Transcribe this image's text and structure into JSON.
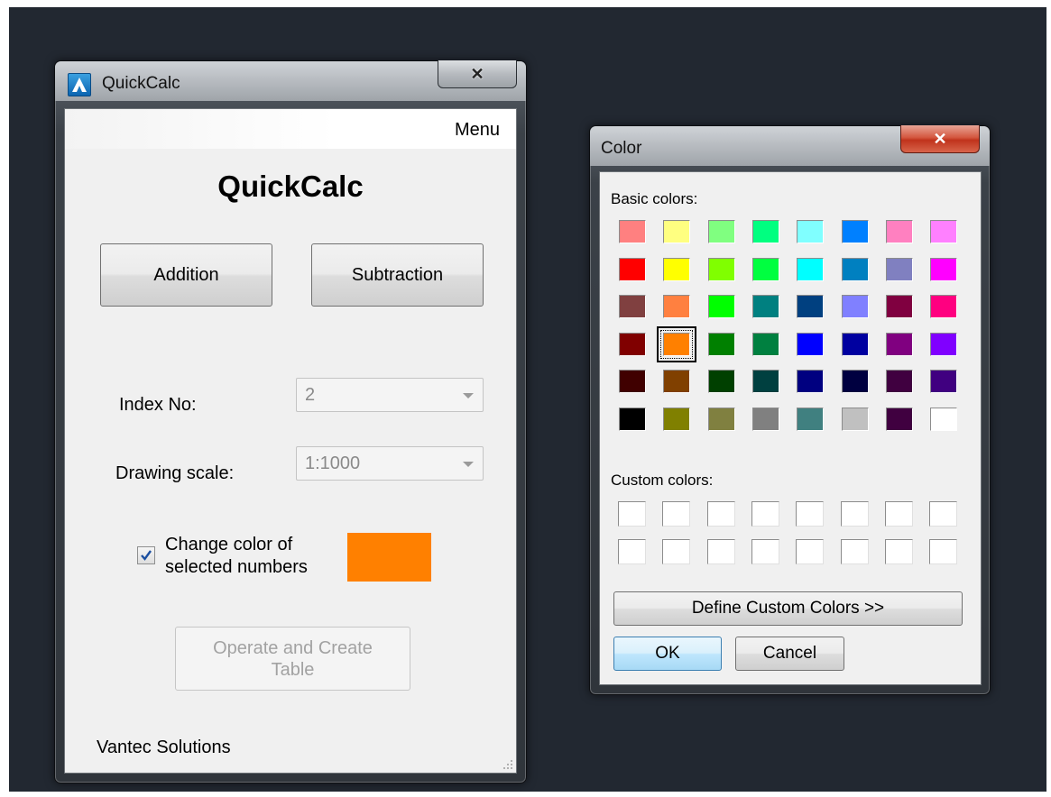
{
  "quickcalc": {
    "window_title": "QuickCalc",
    "close_glyph": "✕",
    "menu_label": "Menu",
    "heading": "QuickCalc",
    "addition_label": "Addition",
    "subtraction_label": "Subtraction",
    "index_label": "Index No:",
    "index_value": "2",
    "scale_label": "Drawing scale:",
    "scale_value": "1:1000",
    "checkbox_checked": true,
    "checkbox_label_line1": "Change color of",
    "checkbox_label_line2": "selected numbers",
    "selected_color": "#ff8000",
    "operate_label_line1": "Operate and Create",
    "operate_label_line2": "Table",
    "company": "Vantec Solutions"
  },
  "color_dialog": {
    "title": "Color",
    "close_glyph": "✕",
    "basic_colors_label": "Basic colors:",
    "basic_colors": [
      [
        "#ff8080",
        "#ffff80",
        "#80ff80",
        "#00ff80",
        "#80ffff",
        "#0080ff",
        "#ff80c0",
        "#ff80ff"
      ],
      [
        "#ff0000",
        "#ffff00",
        "#80ff00",
        "#00ff40",
        "#00ffff",
        "#0080c0",
        "#8080c0",
        "#ff00ff"
      ],
      [
        "#804040",
        "#ff8040",
        "#00ff00",
        "#008080",
        "#004080",
        "#8080ff",
        "#800040",
        "#ff0080"
      ],
      [
        "#800000",
        "#ff8000",
        "#008000",
        "#008040",
        "#0000ff",
        "#0000a0",
        "#800080",
        "#8000ff"
      ],
      [
        "#400000",
        "#804000",
        "#004000",
        "#004040",
        "#000080",
        "#000040",
        "#400040",
        "#400080"
      ],
      [
        "#000000",
        "#808000",
        "#808040",
        "#808080",
        "#408080",
        "#c0c0c0",
        "#400040",
        "#ffffff"
      ]
    ],
    "selected_row": 3,
    "selected_col": 1,
    "custom_colors_label": "Custom colors:",
    "define_custom_label": "Define Custom Colors >>",
    "ok_label": "OK",
    "cancel_label": "Cancel"
  }
}
